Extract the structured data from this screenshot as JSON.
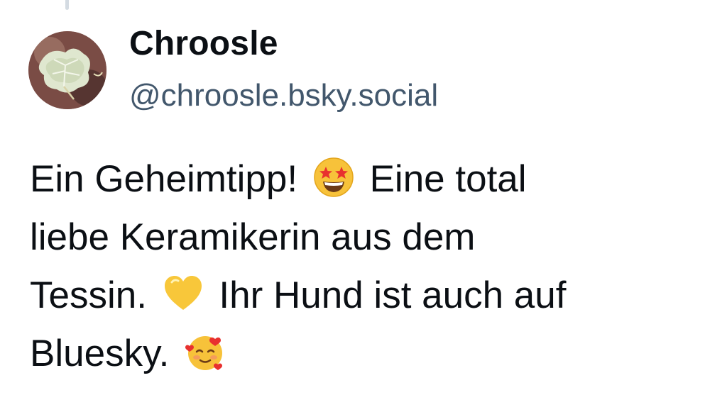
{
  "post": {
    "author": {
      "display_name": "Chroosle",
      "handle": "@chroosle.bsky.social",
      "avatar_icon": "leaf-photo-avatar"
    },
    "text": {
      "segment_1": "Ein Geheimtipp!",
      "emoji_1": "star-struck-emoji",
      "segment_2": "Eine total",
      "segment_3": "liebe Keramikerin aus dem",
      "segment_4": "Tessin.",
      "emoji_2": "yellow-heart-emoji",
      "segment_5": "Ihr Hund ist auch auf",
      "segment_6": "Bluesky.",
      "emoji_3": "smiling-face-with-hearts-emoji"
    }
  },
  "colors": {
    "background": "#ffffff",
    "text_primary": "#0b0f14",
    "text_secondary": "#42576c",
    "thread_line": "#d4dbe2"
  }
}
